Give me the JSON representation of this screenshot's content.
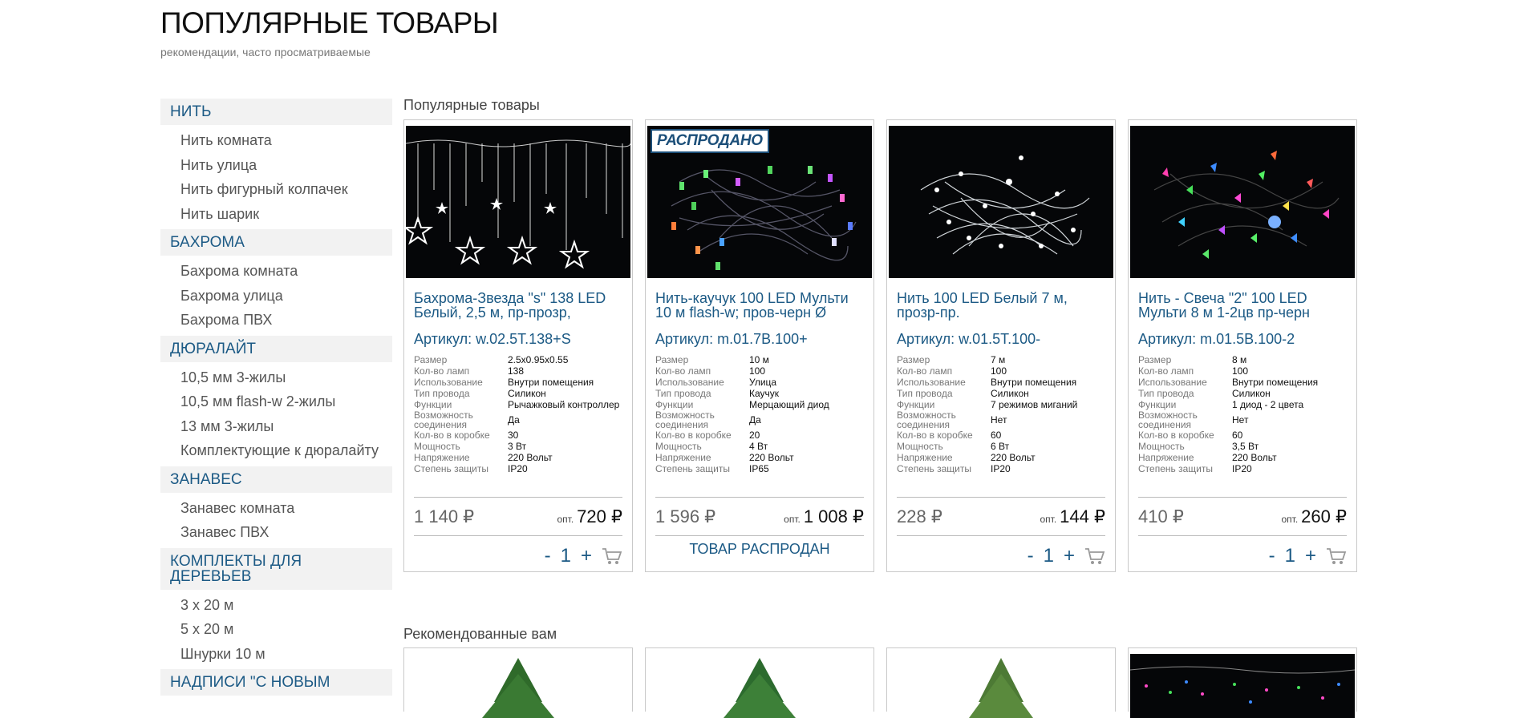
{
  "header": {
    "title": "ПОПУЛЯРНЫЕ ТОВАРЫ",
    "subtitle": "рекомендации, часто просматриваемые"
  },
  "sidebar": {
    "groups": [
      {
        "title": "НИТЬ",
        "items": [
          "Нить комната",
          "Нить улица",
          "Нить фигурный колпачек",
          "Нить шарик"
        ]
      },
      {
        "title": "БАХРОМА",
        "items": [
          "Бахрома комната",
          "Бахрома улица",
          "Бахрома ПВХ"
        ]
      },
      {
        "title": "ДЮРАЛАЙТ",
        "items": [
          "10,5 мм 3-жилы",
          "10,5 мм flash-w 2-жилы",
          "13 мм 3-жилы",
          "Комплектующие к дюралайту"
        ]
      },
      {
        "title": "ЗАНАВЕС",
        "items": [
          "Занавес комната",
          "Занавес ПВХ"
        ]
      },
      {
        "title": "КОМПЛЕКТЫ ДЛЯ ДЕРЕВЬЕВ",
        "items": [
          "3 х 20 м",
          "5 х 20 м",
          "Шнурки 10 м"
        ]
      },
      {
        "title": "НАДПИСИ \"С НОВЫМ",
        "items": []
      }
    ]
  },
  "popular": {
    "title": "Популярные товары",
    "products": [
      {
        "name": "Бахрома-Звезда \"s\" 138 LED Белый, 2,5 м, пр-прозр,",
        "sku": "Артикул: w.02.5T.138+S",
        "specs": [
          {
            "k": "Размер",
            "v": "2.5x0.95x0.55"
          },
          {
            "k": "Кол-во ламп",
            "v": "138"
          },
          {
            "k": "Использование",
            "v": "Внутри помещения"
          },
          {
            "k": "Тип провода",
            "v": "Силикон"
          },
          {
            "k": "Функции",
            "v": "Рычажковый контроллер"
          },
          {
            "k": "Возможность соединения",
            "v": "Да"
          },
          {
            "k": "Кол-во в коробке",
            "v": "30"
          },
          {
            "k": "Мощность",
            "v": "3 Вт"
          },
          {
            "k": "Напряжение",
            "v": "220 Вольт"
          },
          {
            "k": "Степень защиты",
            "v": "IP20"
          }
        ],
        "price": "1 140 ₽",
        "opt_label": "опт.",
        "opt_price": "720 ₽",
        "qty_minus": "-",
        "qty": "1",
        "qty_plus": "+",
        "sold": false
      },
      {
        "name": "Нить-каучук 100 LED Мульти 10 м flash-w; пров-черн Ø",
        "sku": "Артикул: m.01.7B.100+",
        "specs": [
          {
            "k": "Размер",
            "v": "10 м"
          },
          {
            "k": "Кол-во ламп",
            "v": "100"
          },
          {
            "k": "Использование",
            "v": "Улица"
          },
          {
            "k": "Тип провода",
            "v": "Каучук"
          },
          {
            "k": "Функции",
            "v": "Мерцающий диод"
          },
          {
            "k": "Возможность соединения",
            "v": "Да"
          },
          {
            "k": "Кол-во в коробке",
            "v": "20"
          },
          {
            "k": "Мощность",
            "v": "4 Вт"
          },
          {
            "k": "Напряжение",
            "v": "220 Вольт"
          },
          {
            "k": "Степень защиты",
            "v": "IP65"
          }
        ],
        "price": "1 596 ₽",
        "opt_label": "опт.",
        "opt_price": "1 008 ₽",
        "sold": true,
        "sold_badge": "РАСПРОДАНО",
        "sold_text": "ТОВАР РАСПРОДАН"
      },
      {
        "name": "Нить 100 LED Белый 7 м, прозр-пр.",
        "sku": "Артикул: w.01.5T.100-",
        "specs": [
          {
            "k": "Размер",
            "v": "7 м"
          },
          {
            "k": "Кол-во ламп",
            "v": "100"
          },
          {
            "k": "Использование",
            "v": "Внутри помещения"
          },
          {
            "k": "Тип провода",
            "v": "Силикон"
          },
          {
            "k": "Функции",
            "v": "7 режимов миганий"
          },
          {
            "k": "Возможность соединения",
            "v": "Нет"
          },
          {
            "k": "Кол-во в коробке",
            "v": "60"
          },
          {
            "k": "Мощность",
            "v": "6 Вт"
          },
          {
            "k": "Напряжение",
            "v": "220 Вольт"
          },
          {
            "k": "Степень защиты",
            "v": "IP20"
          }
        ],
        "price": "228 ₽",
        "opt_label": "опт.",
        "opt_price": "144 ₽",
        "qty_minus": "-",
        "qty": "1",
        "qty_plus": "+",
        "sold": false
      },
      {
        "name": "Нить - Свеча \"2\" 100 LED Мульти 8 м 1-2цв пр-черн",
        "sku": "Артикул: m.01.5B.100-2",
        "specs": [
          {
            "k": "Размер",
            "v": "8 м"
          },
          {
            "k": "Кол-во ламп",
            "v": "100"
          },
          {
            "k": "Использование",
            "v": "Внутри помещения"
          },
          {
            "k": "Тип провода",
            "v": "Силикон"
          },
          {
            "k": "Функции",
            "v": "1 диод - 2 цвета"
          },
          {
            "k": "Возможность соединения",
            "v": "Нет"
          },
          {
            "k": "Кол-во в коробке",
            "v": "60"
          },
          {
            "k": "Мощность",
            "v": "3,5 Вт"
          },
          {
            "k": "Напряжение",
            "v": "220 Вольт"
          },
          {
            "k": "Степень защиты",
            "v": "IP20"
          }
        ],
        "price": "410 ₽",
        "opt_label": "опт.",
        "opt_price": "260 ₽",
        "qty_minus": "-",
        "qty": "1",
        "qty_plus": "+",
        "sold": false
      }
    ]
  },
  "recommended": {
    "title": "Рекомендованные вам"
  },
  "colors": {
    "accent": "#1c5a85",
    "sidebar_bg": "#f2f2f2",
    "border": "#c9c9c9"
  },
  "icons": [
    "cart-icon"
  ]
}
